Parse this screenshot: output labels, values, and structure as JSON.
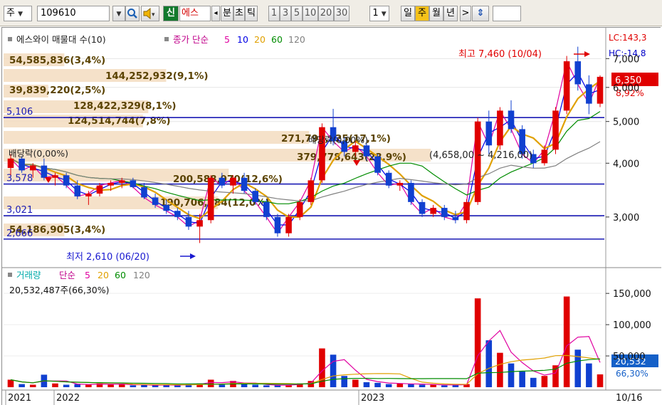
{
  "toolbar": {
    "market_type": "주",
    "stock_code": "109610",
    "new_badge": "신",
    "stock_name": "에스",
    "period_labels": [
      "분",
      "초",
      "틱"
    ],
    "interval_values": [
      "1",
      "3",
      "5",
      "10",
      "20",
      "30"
    ],
    "interval_count": "1",
    "day_label": "일",
    "week_label": "주",
    "month_label": "월",
    "year_label": "년",
    "next_symbol": ">",
    "updown_symbol": "⇕"
  },
  "price_legend": {
    "stock_series": "에스와이 매물대 수(10)",
    "ma_title": "종가 단순",
    "ma_periods": [
      "5",
      "10",
      "20",
      "60",
      "120"
    ],
    "ma_colors": [
      "#e000a0",
      "#0000e6",
      "#e0a000",
      "#008c00",
      "#808080"
    ]
  },
  "volume_legend": {
    "title": "거래량",
    "ma_title": "단순",
    "ma_periods": [
      "5",
      "20",
      "60",
      "120"
    ],
    "ma_colors": [
      "#e000a0",
      "#e0a000",
      "#008c00",
      "#808080"
    ],
    "current_volume": "20,532,487주(66,30%)"
  },
  "volume_profile": [
    {
      "label": "54,585,836(3,4%)",
      "pct": 3.4
    },
    {
      "label": "144,252,932(9,1%)",
      "pct": 9.1
    },
    {
      "label": "39,839,220(2,5%)",
      "pct": 2.5
    },
    {
      "label": "128,422,329(8,1%)",
      "pct": 8.1
    },
    {
      "label": "124,514,744(7,8%)",
      "pct": 7.8
    },
    {
      "label": "271,799,925(17,1%)",
      "pct": 17.1
    },
    {
      "label": "379,778,643(23,9%)",
      "pct": 23.9
    },
    {
      "label": "200,588,970(12,6%)",
      "pct": 12.6
    },
    {
      "label": "190,706,984(12,0%)",
      "pct": 12.0
    },
    {
      "label": "54,186,905(3,4%)",
      "pct": 3.4
    }
  ],
  "annotations": {
    "high_label": "최고 7,460 (10/04)",
    "low_label": "최저 2,610 (06/20)",
    "dividend_left": "배당락(0,00%)",
    "dividend_mid": "배당락(0,00%)",
    "range_label": "(4,658,00 ~ 4,216,00)",
    "lc_label": "LC:143,3",
    "hc_label": "HC:-14,8",
    "last_price": "6,350",
    "change_pct": "8,92%",
    "vol_last": "20,532",
    "vol_pct": "66,30%"
  },
  "horizontal_lines": [
    {
      "label": "5,106",
      "value": 5106
    },
    {
      "label": "3,578",
      "value": 3578
    },
    {
      "label": "3,021",
      "value": 3021
    },
    {
      "label": "2,666",
      "value": 2666
    }
  ],
  "price_axis_ticks": [
    "7,000",
    "6,000",
    "5,000",
    "4,000",
    "3,000"
  ],
  "volume_axis_ticks": [
    "150,000",
    "100,000",
    "50,000"
  ],
  "date_axis": {
    "labels": [
      "2021",
      "2022",
      "2023"
    ],
    "last_date": "10/16"
  },
  "chart_data": {
    "type": "candlestick",
    "title": "",
    "price_ticks": [
      7000,
      6000,
      5000,
      4000,
      3000
    ],
    "volume_ticks_thousands": [
      150000,
      100000,
      50000
    ],
    "last_close": 6350,
    "high": 7460,
    "low": 2610,
    "candles": [
      [
        3900,
        4200,
        3750,
        4100
      ],
      [
        4100,
        4150,
        3800,
        3850
      ],
      [
        3850,
        4000,
        3700,
        3950
      ],
      [
        3950,
        4100,
        3650,
        3700
      ],
      [
        3700,
        3800,
        3550,
        3750
      ],
      [
        3750,
        3800,
        3500,
        3550
      ],
      [
        3550,
        3650,
        3300,
        3350
      ],
      [
        3350,
        3450,
        3200,
        3400
      ],
      [
        3400,
        3600,
        3350,
        3550
      ],
      [
        3550,
        3650,
        3450,
        3600
      ],
      [
        3600,
        3700,
        3500,
        3650
      ],
      [
        3650,
        3700,
        3500,
        3520
      ],
      [
        3520,
        3600,
        3300,
        3330
      ],
      [
        3330,
        3400,
        3150,
        3200
      ],
      [
        3200,
        3300,
        3050,
        3100
      ],
      [
        3100,
        3150,
        2950,
        3000
      ],
      [
        3000,
        3100,
        2800,
        2850
      ],
      [
        2850,
        3050,
        2610,
        2950
      ],
      [
        2950,
        3750,
        2900,
        3700
      ],
      [
        3700,
        3800,
        3500,
        3550
      ],
      [
        3550,
        3750,
        3400,
        3700
      ],
      [
        3700,
        3800,
        3400,
        3450
      ],
      [
        3450,
        3500,
        3200,
        3250
      ],
      [
        3250,
        3300,
        2950,
        3000
      ],
      [
        3000,
        3050,
        2700,
        2750
      ],
      [
        2750,
        3050,
        2700,
        3000
      ],
      [
        3000,
        3300,
        2950,
        3250
      ],
      [
        3250,
        3700,
        3200,
        3650
      ],
      [
        3650,
        4950,
        3600,
        4850
      ],
      [
        4850,
        5350,
        4400,
        4500
      ],
      [
        4500,
        4600,
        4150,
        4250
      ],
      [
        4250,
        4500,
        4150,
        4400
      ],
      [
        4400,
        4450,
        4050,
        4150
      ],
      [
        4150,
        4200,
        3750,
        3800
      ],
      [
        3800,
        3850,
        3500,
        3550
      ],
      [
        3550,
        3650,
        3450,
        3600
      ],
      [
        3600,
        3650,
        3200,
        3250
      ],
      [
        3250,
        3300,
        3000,
        3050
      ],
      [
        3050,
        3200,
        3000,
        3150
      ],
      [
        3150,
        3200,
        2950,
        3000
      ],
      [
        3000,
        3100,
        2900,
        2950
      ],
      [
        2950,
        3300,
        2900,
        3250
      ],
      [
        3250,
        5100,
        3200,
        5000
      ],
      [
        5000,
        5300,
        4200,
        4400
      ],
      [
        4400,
        5400,
        4300,
        5300
      ],
      [
        5300,
        5600,
        4700,
        4800
      ],
      [
        4800,
        4900,
        4100,
        4200
      ],
      [
        4200,
        4300,
        3900,
        4000
      ],
      [
        4000,
        4400,
        3950,
        4300
      ],
      [
        4300,
        5400,
        4200,
        5300
      ],
      [
        5300,
        7100,
        5200,
        6900
      ],
      [
        6900,
        7460,
        5900,
        6100
      ],
      [
        6100,
        6400,
        5200,
        5500
      ],
      [
        5500,
        6400,
        5400,
        6350
      ]
    ],
    "volumes_thousands": [
      12,
      5,
      4,
      20,
      6,
      4,
      5,
      4,
      6,
      4,
      5,
      3,
      4,
      3,
      4,
      3,
      5,
      6,
      12,
      4,
      10,
      6,
      4,
      3,
      3,
      4,
      6,
      10,
      62,
      52,
      18,
      12,
      8,
      7,
      5,
      6,
      5,
      4,
      4,
      3,
      4,
      5,
      142,
      75,
      55,
      38,
      25,
      15,
      18,
      35,
      145,
      60,
      38,
      20.5
    ]
  }
}
